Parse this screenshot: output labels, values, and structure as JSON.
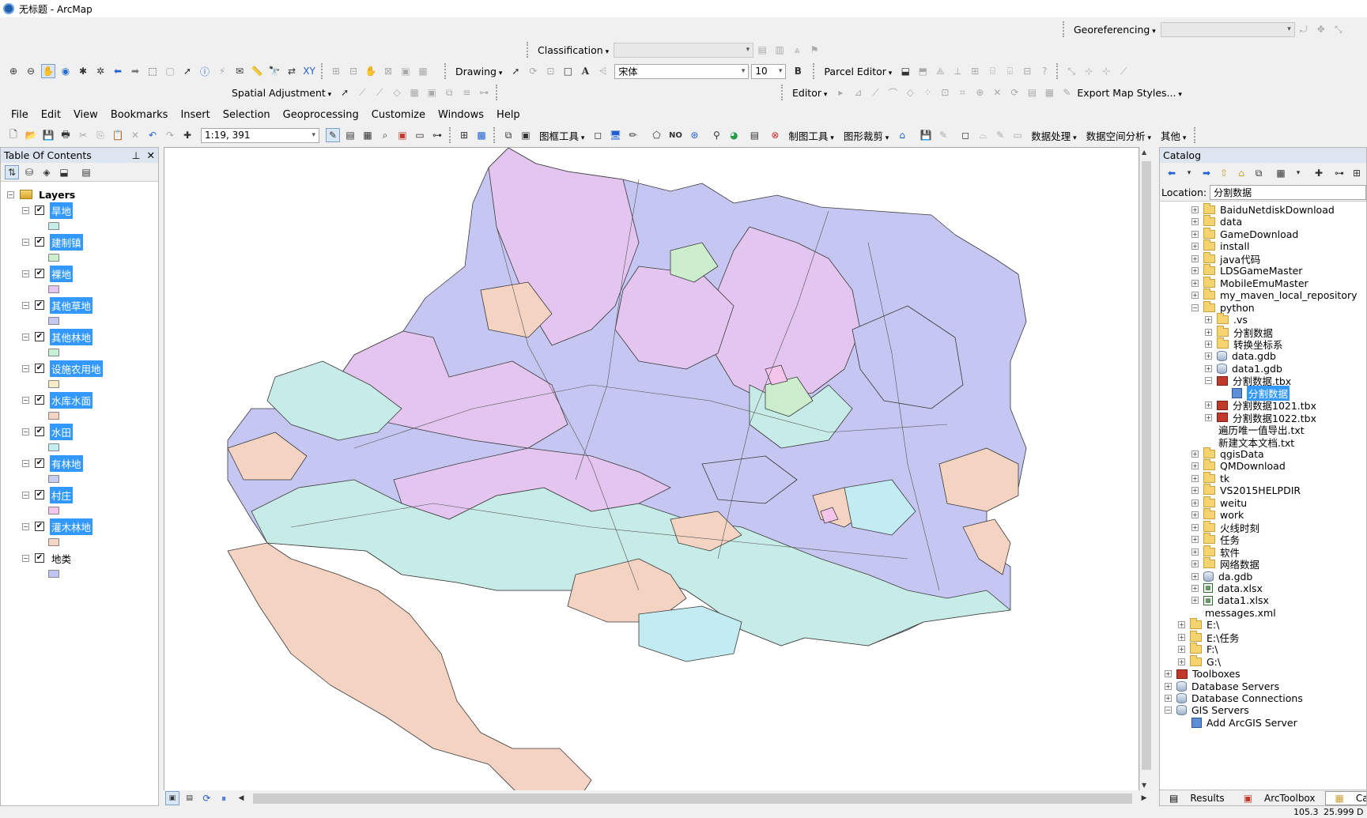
{
  "window": {
    "title": "无标题 - ArcMap"
  },
  "toolbars": {
    "georeferencing_label": "Georeferencing",
    "classification_label": "Classification",
    "drawing_label": "Drawing",
    "font_name": "宋体",
    "font_size": "10",
    "bold_label": "B",
    "parcel_editor_label": "Parcel Editor",
    "spatial_adjustment_label": "Spatial Adjustment",
    "editor_label": "Editor",
    "export_map_styles_label": "Export Map Styles...",
    "scale_value": "1:19, 391",
    "frame_tools_label": "图框工具",
    "no_label": "NO",
    "mapping_tools_label": "制图工具",
    "graphic_clip_label": "图形裁剪",
    "data_processing_label": "数据处理",
    "spatial_analysis_label": "数据空间分析",
    "other_label": "其他"
  },
  "menu": [
    "File",
    "Edit",
    "View",
    "Bookmarks",
    "Insert",
    "Selection",
    "Geoprocessing",
    "Customize",
    "Windows",
    "Help"
  ],
  "toc": {
    "title": "Table Of Contents",
    "root": "Layers",
    "layers": [
      {
        "name": "旱地",
        "color": "#c7ece8",
        "selected": true
      },
      {
        "name": "建制镇",
        "color": "#cdeecd",
        "selected": true
      },
      {
        "name": "裸地",
        "color": "#e3c5f0",
        "selected": true
      },
      {
        "name": "其他草地",
        "color": "#c6c6f2",
        "selected": true
      },
      {
        "name": "其他林地",
        "color": "#c6efd6",
        "selected": true
      },
      {
        "name": "设施农用地",
        "color": "#f4ecc6",
        "selected": true
      },
      {
        "name": "水库水面",
        "color": "#f4d3c2",
        "selected": true
      },
      {
        "name": "水田",
        "color": "#c3ebf2",
        "selected": true
      },
      {
        "name": "有林地",
        "color": "#c7cdef",
        "selected": true
      },
      {
        "name": "村庄",
        "color": "#f4c4ea",
        "selected": true
      },
      {
        "name": "灌木林地",
        "color": "#f4d6c4",
        "selected": true
      },
      {
        "name": "地类",
        "color": "#bfc4f0",
        "selected": false
      }
    ]
  },
  "catalog": {
    "title": "Catalog",
    "location_label": "Location:",
    "location_value": "分割数据",
    "items": [
      {
        "label": "BaiduNetdiskDownload",
        "icon": "folder",
        "level": 2,
        "exp": "+"
      },
      {
        "label": "data",
        "icon": "folder",
        "level": 2,
        "exp": "+"
      },
      {
        "label": "GameDownload",
        "icon": "folder",
        "level": 2,
        "exp": "+"
      },
      {
        "label": "install",
        "icon": "folder",
        "level": 2,
        "exp": "+"
      },
      {
        "label": "java代码",
        "icon": "folder",
        "level": 2,
        "exp": "+"
      },
      {
        "label": "LDSGameMaster",
        "icon": "folder",
        "level": 2,
        "exp": "+"
      },
      {
        "label": "MobileEmuMaster",
        "icon": "folder",
        "level": 2,
        "exp": "+"
      },
      {
        "label": "my_maven_local_repository",
        "icon": "folder",
        "level": 2,
        "exp": "+"
      },
      {
        "label": "python",
        "icon": "folder",
        "level": 2,
        "exp": "-"
      },
      {
        "label": ".vs",
        "icon": "folder",
        "level": 3,
        "exp": "+"
      },
      {
        "label": "分割数据",
        "icon": "folder",
        "level": 3,
        "exp": "+"
      },
      {
        "label": "转换坐标系",
        "icon": "folder",
        "level": 3,
        "exp": "+"
      },
      {
        "label": "data.gdb",
        "icon": "gdb",
        "level": 3,
        "exp": "+"
      },
      {
        "label": "data1.gdb",
        "icon": "gdb",
        "level": 3,
        "exp": "+"
      },
      {
        "label": "分割数据.tbx",
        "icon": "tbx",
        "level": 3,
        "exp": "-"
      },
      {
        "label": "分割数据",
        "icon": "script",
        "level": 4,
        "exp": "",
        "selected": true
      },
      {
        "label": "分割数据1021.tbx",
        "icon": "tbx",
        "level": 3,
        "exp": "+"
      },
      {
        "label": "分割数据1022.tbx",
        "icon": "tbx",
        "level": 3,
        "exp": "+"
      },
      {
        "label": "遍历唯一值导出.txt",
        "icon": "txt",
        "level": 3,
        "exp": ""
      },
      {
        "label": "新建文本文档.txt",
        "icon": "txt",
        "level": 3,
        "exp": ""
      },
      {
        "label": "qgisData",
        "icon": "folder",
        "level": 2,
        "exp": "+"
      },
      {
        "label": "QMDownload",
        "icon": "folder",
        "level": 2,
        "exp": "+"
      },
      {
        "label": "tk",
        "icon": "folder",
        "level": 2,
        "exp": "+"
      },
      {
        "label": "VS2015HELPDIR",
        "icon": "folder",
        "level": 2,
        "exp": "+"
      },
      {
        "label": "weitu",
        "icon": "folder",
        "level": 2,
        "exp": "+"
      },
      {
        "label": "work",
        "icon": "folder",
        "level": 2,
        "exp": "+"
      },
      {
        "label": "火线时刻",
        "icon": "folder",
        "level": 2,
        "exp": "+"
      },
      {
        "label": "任务",
        "icon": "folder",
        "level": 2,
        "exp": "+"
      },
      {
        "label": "软件",
        "icon": "folder",
        "level": 2,
        "exp": "+"
      },
      {
        "label": "网络数据",
        "icon": "folder",
        "level": 2,
        "exp": "+"
      },
      {
        "label": "da.gdb",
        "icon": "gdb",
        "level": 2,
        "exp": "+"
      },
      {
        "label": "data.xlsx",
        "icon": "xls",
        "level": 2,
        "exp": "+"
      },
      {
        "label": "data1.xlsx",
        "icon": "xls",
        "level": 2,
        "exp": "+"
      },
      {
        "label": "messages.xml",
        "icon": "txt",
        "level": 2,
        "exp": ""
      },
      {
        "label": "E:\\",
        "icon": "folder",
        "level": 1,
        "exp": "+"
      },
      {
        "label": "E:\\任务",
        "icon": "folder",
        "level": 1,
        "exp": "+"
      },
      {
        "label": "F:\\",
        "icon": "folder",
        "level": 1,
        "exp": "+"
      },
      {
        "label": "G:\\",
        "icon": "folder",
        "level": 1,
        "exp": "+"
      },
      {
        "label": "Toolboxes",
        "icon": "tbx",
        "level": 0,
        "exp": "+"
      },
      {
        "label": "Database Servers",
        "icon": "gdb",
        "level": 0,
        "exp": "+"
      },
      {
        "label": "Database Connections",
        "icon": "gdb",
        "level": 0,
        "exp": "+"
      },
      {
        "label": "GIS Servers",
        "icon": "gdb",
        "level": 0,
        "exp": "-"
      },
      {
        "label": "Add ArcGIS Server",
        "icon": "script",
        "level": 1,
        "exp": ""
      }
    ],
    "tabs": [
      "Results",
      "ArcToolbox",
      "Catalog"
    ]
  },
  "status": {
    "coord_x": "105.3",
    "coord_y": "25.999 D"
  },
  "map": {
    "colors": {
      "lavender": "#c6c6f2",
      "violet": "#e3c5f0",
      "mint": "#c7ece8",
      "peach": "#f4d3c2",
      "green": "#cdeecd",
      "pink": "#f4c4ea",
      "cyan": "#c3ebf2"
    }
  }
}
